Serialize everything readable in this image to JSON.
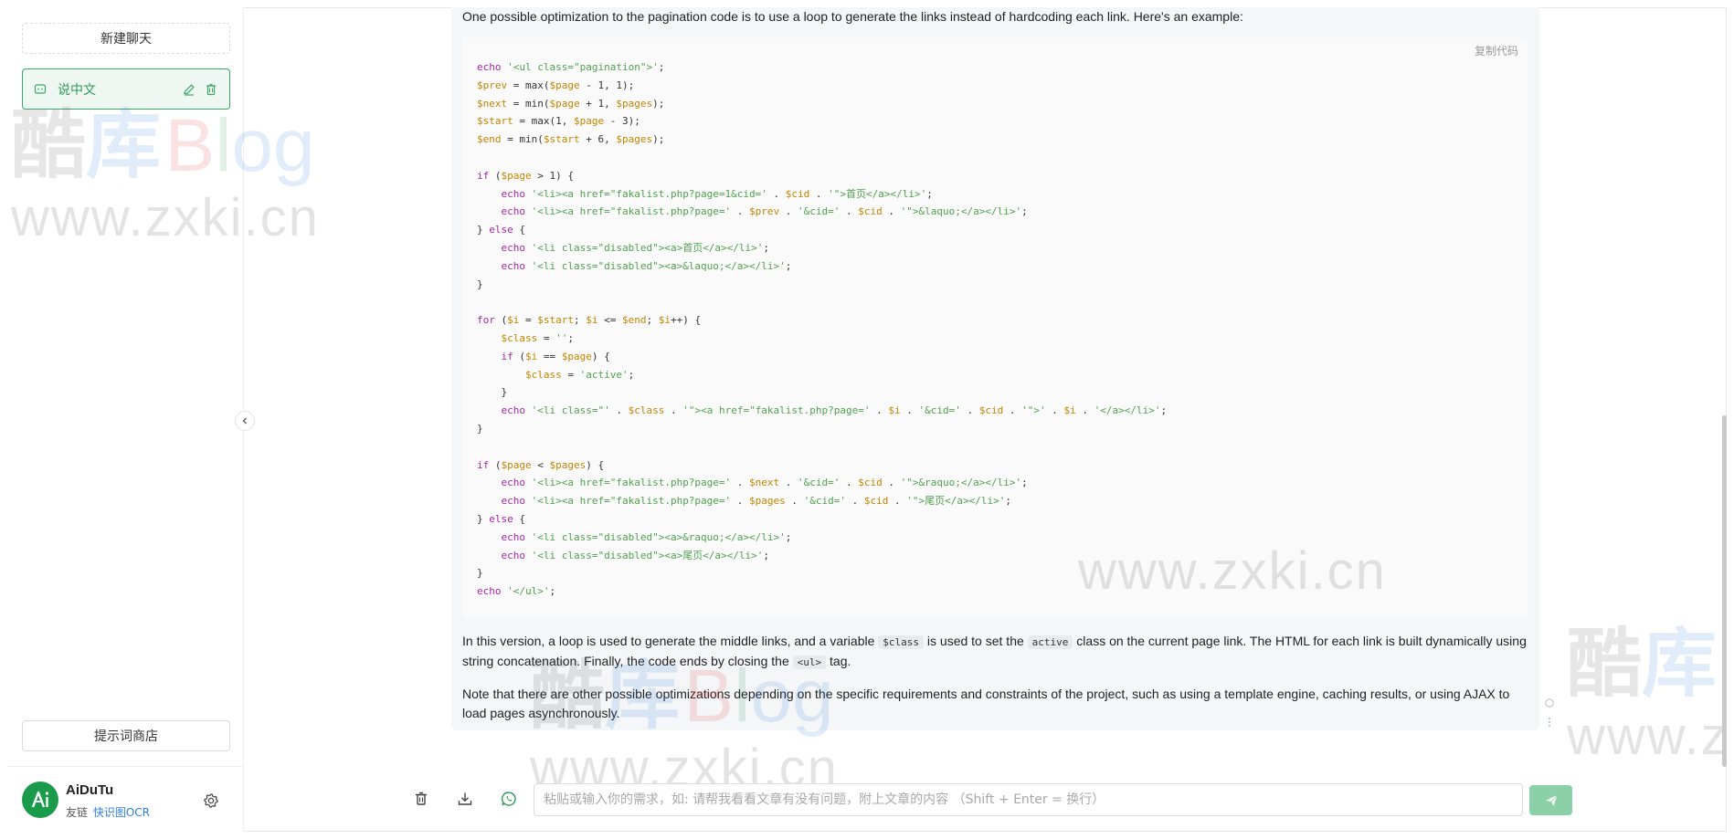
{
  "sidebar": {
    "new_chat_label": "新建聊天",
    "chats": [
      {
        "label": "说中文",
        "active": true
      }
    ],
    "store_label": "提示词商店",
    "user": {
      "name": "AiDuTu",
      "friend_prefix": "友链",
      "friend_link": "快识图OCR"
    }
  },
  "message": {
    "intro": "One possible optimization to the pagination code is to use a loop to generate the links instead of hardcoding each link. Here's an example:",
    "copy_label": "复制代码",
    "code_lines": [
      "echo '<ul class=\"pagination\">';",
      "$prev = max($page - 1, 1);",
      "$next = min($page + 1, $pages);",
      "$start = max(1, $page - 3);",
      "$end = min($start + 6, $pages);",
      "",
      "if ($page > 1) {",
      "    echo '<li><a href=\"fakalist.php?page=1&cid=' . $cid . '\">首页</a></li>';",
      "    echo '<li><a href=\"fakalist.php?page=' . $prev . '&cid=' . $cid . '\">&laquo;</a></li>';",
      "} else {",
      "    echo '<li class=\"disabled\"><a>首页</a></li>';",
      "    echo '<li class=\"disabled\"><a>&laquo;</a></li>';",
      "}",
      "",
      "for ($i = $start; $i <= $end; $i++) {",
      "    $class = '';",
      "    if ($i == $page) {",
      "        $class = 'active';",
      "    }",
      "    echo '<li class=\"' . $class . '\"><a href=\"fakalist.php?page=' . $i . '&cid=' . $cid . '\">' . $i . '</a></li>';",
      "}",
      "",
      "if ($page < $pages) {",
      "    echo '<li><a href=\"fakalist.php?page=' . $next . '&cid=' . $cid . '\">&raquo;</a></li>';",
      "    echo '<li><a href=\"fakalist.php?page=' . $pages . '&cid=' . $cid . '\">尾页</a></li>';",
      "} else {",
      "    echo '<li class=\"disabled\"><a>&raquo;</a></li>';",
      "    echo '<li class=\"disabled\"><a>尾页</a></li>';",
      "}",
      "echo '</ul>';"
    ],
    "para1": {
      "t1": "In this version, a loop is used to generate the middle links, and a variable",
      "c1": "$class",
      "t2": "is used to set the",
      "c2": "active",
      "t3": "class on the current page link. The HTML for each link is built dynamically using string concatenation. Finally, the code ends by closing the",
      "c3": "<ul>",
      "t4": "tag."
    },
    "para2": "Note that there are other possible optimizations depending on the specific requirements and constraints of the project, such as using a template engine, caching results, or using AJAX to load pages asynchronously."
  },
  "input": {
    "placeholder": "粘贴或输入你的需求，如: 请帮我看看文章有没有问题，附上文章的内容 （Shift + Enter = 换行）"
  },
  "watermark": {
    "brand": [
      "酷",
      "库",
      "B",
      "l",
      "og"
    ],
    "url": "www.zxki.cn"
  },
  "colors": {
    "accent": "#3aa864",
    "send_button": "#8bd0a7",
    "bubble_bg": "#f4f6f8",
    "code_bg": "#fafafa"
  }
}
